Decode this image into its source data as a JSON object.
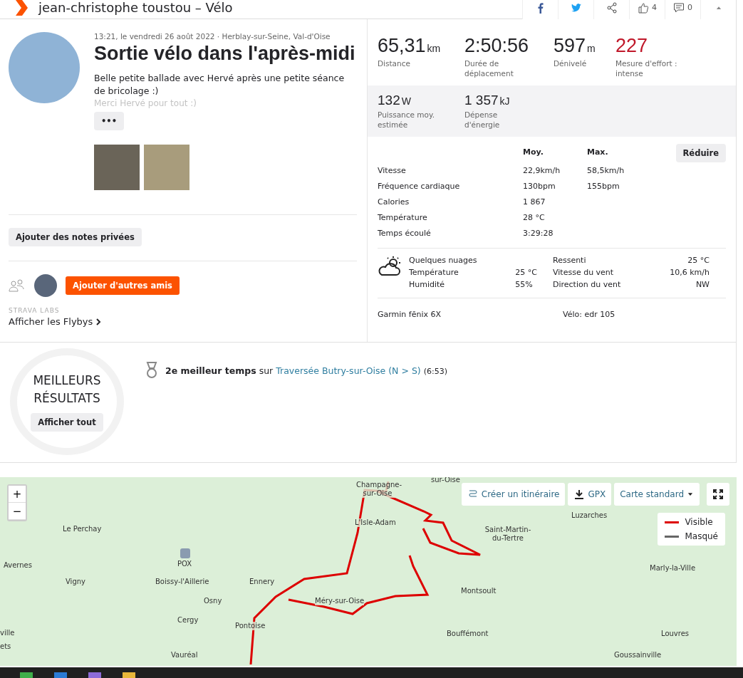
{
  "header": {
    "title": "jean-christophe toustou – Vélo",
    "kudos_count": "4",
    "comments_count": "0"
  },
  "activity": {
    "meta": "13:21, le vendredi 26 août 2022 · Herblay-sur-Seine, Val-d'Oise",
    "title": "Sortie vélo dans l'après-midi",
    "description": "Belle petite ballade avec Hervé après une petite séance de bricolage :)",
    "description_faded": "Merci Hervé pour tout :)",
    "more_button": "•••"
  },
  "private_notes_button": "Ajouter des notes privées",
  "add_friends_button": "Ajouter d'autres amis",
  "labs": {
    "caption": "STRAVA LABS",
    "link": "Afficher les Flybys"
  },
  "primary_stats": [
    {
      "value": "65,31",
      "unit": "km",
      "label": "Distance",
      "highlight": false
    },
    {
      "value": "2:50:56",
      "label": "Durée de déplacement",
      "highlight": false
    },
    {
      "value": "597",
      "unit": "m",
      "label": "Dénivelé",
      "highlight": false
    },
    {
      "value": "227",
      "label": "Mesure d'effort : intense",
      "highlight": true
    }
  ],
  "secondary_stats": [
    {
      "value": "132",
      "unit": "W",
      "label": "Puissance moy. estimée"
    },
    {
      "value": "1 357",
      "unit": "kJ",
      "label": "Dépense d'énergie"
    }
  ],
  "details": {
    "columns": [
      "Moy.",
      "Max."
    ],
    "collapse_button": "Réduire",
    "rows": [
      {
        "label": "Vitesse",
        "avg": "22,9km/h",
        "max": "58,5km/h"
      },
      {
        "label": "Fréquence cardiaque",
        "avg": "130bpm",
        "max": "155bpm"
      },
      {
        "label": "Calories",
        "avg": "1 867"
      },
      {
        "label": "Température",
        "avg": "28 °C"
      },
      {
        "label": "Temps écoulé",
        "avg": "3:29:28"
      }
    ]
  },
  "weather": {
    "condition": "Quelques nuages",
    "left": [
      {
        "label": "Température",
        "value": "25 °C"
      },
      {
        "label": "Humidité",
        "value": "55%"
      }
    ],
    "right": [
      {
        "label": "Ressenti",
        "value": "25 °C"
      },
      {
        "label": "Vitesse du vent",
        "value": "10,6 km/h"
      },
      {
        "label": "Direction du vent",
        "value": "NW"
      }
    ]
  },
  "device": "Garmin fēnix 6X",
  "bike": "Vélo: edr 105",
  "best_results": {
    "title_1": "MEILLEURS",
    "title_2": "RÉSULTATS",
    "button": "Afficher tout",
    "achievement_bold": "2e meilleur temps",
    "achievement_join": "sur",
    "segment": "Traversée Butry-sur-Oise (N > S)",
    "time": "(6:53)"
  },
  "map": {
    "zoom_in": "+",
    "zoom_out": "−",
    "route_button": "Créer un itinéraire",
    "gpx_button": "GPX",
    "map_type": "Carte standard",
    "legend": [
      {
        "label": "Visible",
        "color": "#dd0000"
      },
      {
        "label": "Masqué",
        "color": "#666666"
      }
    ],
    "places": [
      "sur-Oise",
      "Champagne-sur-Oise",
      "Luzarches",
      "L'Isle-Adam",
      "Le Perchay",
      "Saint-Martin-du-Tertre",
      "Avernes",
      "Marly-la-Ville",
      "Vigny",
      "Boissy-l'Aillerie",
      "Ennery",
      "Montsoult",
      "Osny",
      "Méry-sur-Oise",
      "Cergy",
      "Pontoise",
      "ville",
      "Bouffémont",
      "Louvres",
      "ets",
      "Vauréal",
      "Goussainville"
    ],
    "airport": "POX"
  }
}
